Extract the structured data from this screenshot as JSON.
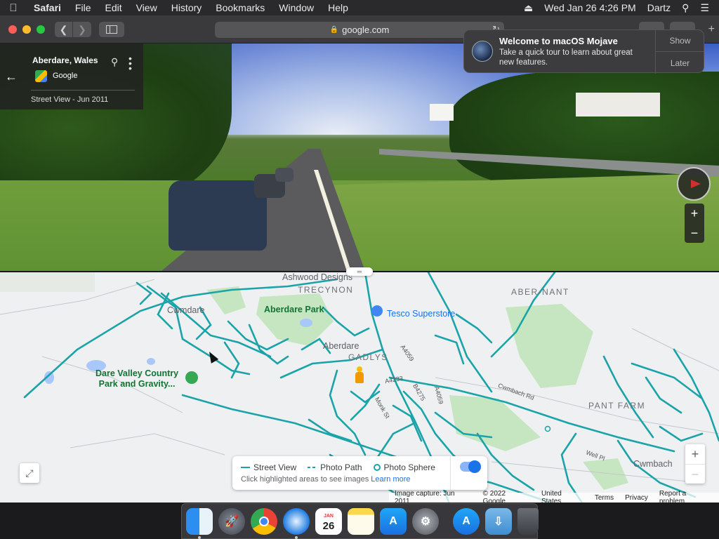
{
  "menubar": {
    "app": "Safari",
    "items": [
      "File",
      "Edit",
      "View",
      "History",
      "Bookmarks",
      "Window",
      "Help"
    ],
    "datetime": "Wed Jan 26  4:26 PM",
    "user": "Dartz"
  },
  "browser": {
    "url": "google.com"
  },
  "notification": {
    "title": "Welcome to macOS Mojave",
    "body": "Take a quick tour to learn about great new features.",
    "show_label": "Show",
    "later_label": "Later"
  },
  "streetview": {
    "location_title": "Aberdare, Wales",
    "provider": "Google",
    "capture_date": "Street View - Jun 2011"
  },
  "map": {
    "labels": {
      "ashwood": "Ashwood Designs",
      "trecynon": "TRECYNON",
      "abernant": "ABER-NANT",
      "cwmdare": "Cwmdare",
      "aberdare_park": "Aberdare Park",
      "tesco": "Tesco Superstore",
      "aberdare": "Aberdare",
      "gadlys": "GADLYS",
      "dare_valley_1": "Dare Valley Country",
      "dare_valley_2": "Park and Gravity...",
      "pant_farm": "PANT FARM",
      "cwmbach": "Cwmbach",
      "cwmbach_rd": "Cwmbach Rd",
      "a4059": "A4059",
      "a4233": "A4233",
      "b4275": "B4275",
      "a4059b": "A4059",
      "monk_st": "Monk St",
      "well_pl": "Well Pl"
    },
    "legend": {
      "street_view": "Street View",
      "photo_path": "Photo Path",
      "photo_sphere": "Photo Sphere",
      "hint": "Click highlighted areas to see images",
      "learn_more": "Learn more",
      "layer_enabled": true
    },
    "footer": {
      "capture": "Image capture: Jun 2011",
      "copyright": "© 2022 Google",
      "region": "United States",
      "terms": "Terms",
      "privacy": "Privacy",
      "report": "Report a problem"
    }
  },
  "dock": {
    "apps": [
      "Finder",
      "Launchpad",
      "Chrome",
      "Safari",
      "Calendar",
      "Notes",
      "App Store",
      "System Preferences",
      "App Store",
      "Downloads",
      "Trash"
    ],
    "calendar_day": "26",
    "calendar_month": "JAN"
  },
  "colors": {
    "coverage": "#1aa3a8",
    "accent": "#1a73e8",
    "park": "#c6e6c2"
  }
}
